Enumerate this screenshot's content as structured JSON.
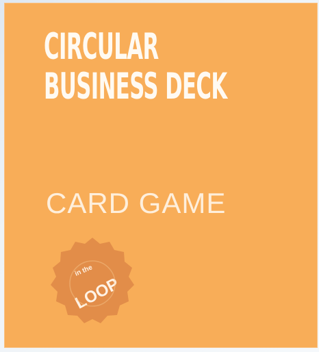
{
  "card": {
    "title_line_1": "CIRCULAR",
    "title_line_2": "BUSINESS DECK",
    "subtitle": "CARD GAME"
  },
  "logo": {
    "badge_icon": "loop-badge-icon",
    "top_text": "in the",
    "main_text": "LOOP"
  },
  "colors": {
    "card_background": "#f8ad58",
    "badge_fill": "#df8a48",
    "text": "#fffaf2"
  }
}
